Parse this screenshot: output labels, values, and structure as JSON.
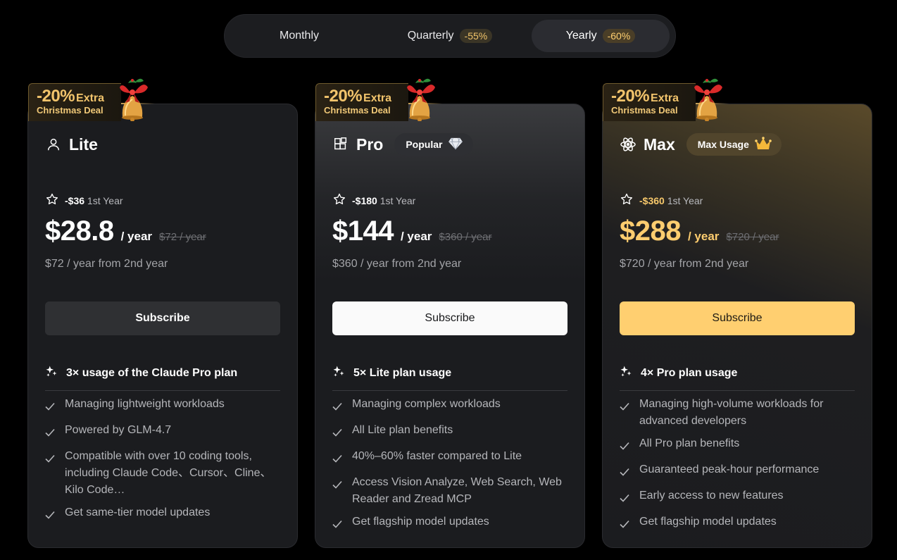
{
  "toggle": {
    "options": [
      {
        "label": "Monthly",
        "discount": ""
      },
      {
        "label": "Quarterly",
        "discount": "-55%"
      },
      {
        "label": "Yearly",
        "discount": "-60%"
      }
    ],
    "selected": "Yearly"
  },
  "promo": {
    "pct": "-20%",
    "extra": "Extra",
    "deal": "Christmas Deal"
  },
  "plans": [
    {
      "name": "Lite",
      "icon": "user-icon",
      "badge": "",
      "save_amount": "-$36",
      "save_suffix": "1st Year",
      "price": "$28.8",
      "per": "/ year",
      "original": "$72 / year",
      "renewal": "$72 / year from 2nd year",
      "cta": "Subscribe",
      "feature_head": "3× usage of the Claude Pro plan",
      "features": [
        "Managing lightweight workloads",
        "Powered by GLM-4.7",
        "Compatible with over 10 coding tools, including Claude Code、Cursor、Cline、Kilo Code…",
        "Get same-tier model updates"
      ]
    },
    {
      "name": "Pro",
      "icon": "blocks-icon",
      "badge": "Popular",
      "save_amount": "-$180",
      "save_suffix": "1st Year",
      "price": "$144",
      "per": "/ year",
      "original": "$360 / year",
      "renewal": "$360 / year from 2nd year",
      "cta": "Subscribe",
      "feature_head": "5× Lite plan usage",
      "features": [
        "Managing complex workloads",
        "All Lite plan benefits",
        "40%–60% faster compared to Lite",
        "Access Vision Analyze, Web Search, Web Reader and Zread MCP",
        "Get flagship model updates"
      ]
    },
    {
      "name": "Max",
      "icon": "atom-icon",
      "badge": "Max Usage",
      "save_amount": "-$360",
      "save_suffix": "1st Year",
      "price": "$288",
      "per": "/ year",
      "original": "$720 / year",
      "renewal": "$720 / year from 2nd year",
      "cta": "Subscribe",
      "feature_head": "4× Pro plan usage",
      "features": [
        "Managing high-volume workloads for advanced developers",
        "All Pro plan benefits",
        "Guaranteed peak-hour performance",
        "Early access to new features",
        "Get flagship model updates"
      ]
    }
  ],
  "colors": {
    "gold": "#ffcf70",
    "background": "#000000",
    "card": "#1b1c1f"
  }
}
